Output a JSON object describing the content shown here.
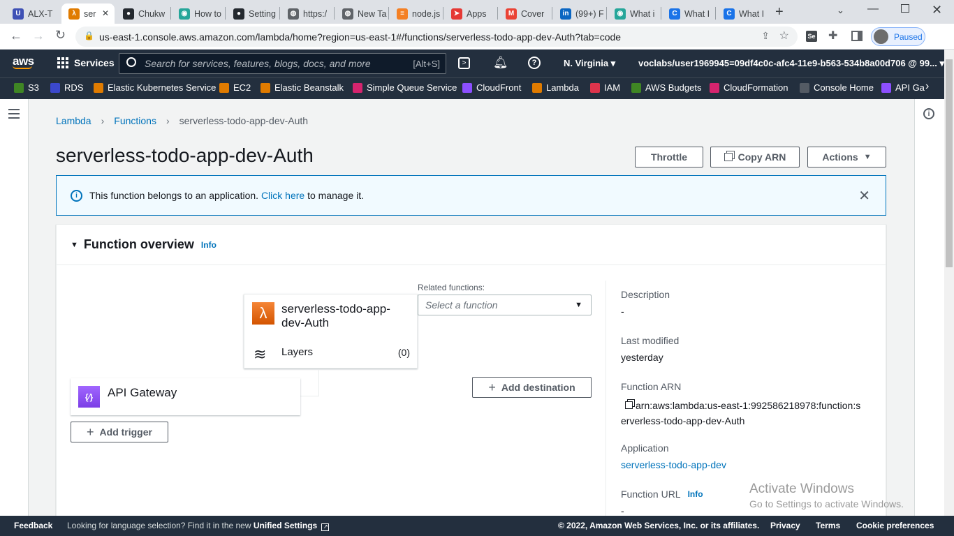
{
  "browser": {
    "tabs": [
      {
        "title": "ALX-T",
        "color": "#3f51b5",
        "glyph": "U"
      },
      {
        "title": "ser",
        "color": "#e07b00",
        "glyph": "λ",
        "active": true
      },
      {
        "title": "Chukw",
        "color": "#24292f",
        "glyph": "●"
      },
      {
        "title": "How to",
        "color": "#26a69a",
        "glyph": "◉"
      },
      {
        "title": "Setting",
        "color": "#24292f",
        "glyph": "●"
      },
      {
        "title": "https:/",
        "color": "#5f6368",
        "glyph": "◍"
      },
      {
        "title": "New Ta",
        "color": "#5f6368",
        "glyph": "◍"
      },
      {
        "title": "node.js",
        "color": "#f48024",
        "glyph": "≡"
      },
      {
        "title": "Apps",
        "color": "#e53935",
        "glyph": "➤"
      },
      {
        "title": "Cover",
        "color": "#ea4335",
        "glyph": "M"
      },
      {
        "title": "(99+) F",
        "color": "#0a66c2",
        "glyph": "in"
      },
      {
        "title": "What i",
        "color": "#26a69a",
        "glyph": "◉"
      },
      {
        "title": "What I",
        "color": "#1a73e8",
        "glyph": "C"
      },
      {
        "title": "What I",
        "color": "#1a73e8",
        "glyph": "C"
      }
    ],
    "url": "us-east-1.console.aws.amazon.com/lambda/home?region=us-east-1#/functions/serverless-todo-app-dev-Auth?tab=code",
    "profile_status": "Paused"
  },
  "awsnav": {
    "logo": "aws",
    "services_label": "Services",
    "search_placeholder": "Search for services, features, blogs, docs, and more",
    "search_shortcut": "[Alt+S]",
    "region": "N. Virginia",
    "account": "voclabs/user1969945=09df4c0c-afc4-11e9-b563-534b8a00d706 @ 99..."
  },
  "favorites": [
    {
      "label": "S3",
      "color": "#3f8624"
    },
    {
      "label": "RDS",
      "color": "#3b48cc"
    },
    {
      "label": "Elastic Kubernetes Service",
      "color": "#e07b00"
    },
    {
      "label": "EC2",
      "color": "#e07b00"
    },
    {
      "label": "Elastic Beanstalk",
      "color": "#e07b00"
    },
    {
      "label": "Simple Queue Service",
      "color": "#d6246e"
    },
    {
      "label": "CloudFront",
      "color": "#8c4fff"
    },
    {
      "label": "Lambda",
      "color": "#e07b00"
    },
    {
      "label": "IAM",
      "color": "#dd344c"
    },
    {
      "label": "AWS Budgets",
      "color": "#3f8624"
    },
    {
      "label": "CloudFormation",
      "color": "#d6246e"
    },
    {
      "label": "Console Home",
      "color": "#545b64"
    },
    {
      "label": "API Ga",
      "color": "#8c4fff"
    }
  ],
  "breadcrumb": {
    "root": "Lambda",
    "functions": "Functions",
    "current": "serverless-todo-app-dev-Auth"
  },
  "page_title": "serverless-todo-app-dev-Auth",
  "actions": {
    "throttle": "Throttle",
    "copy_arn": "Copy ARN",
    "actions": "Actions"
  },
  "alert": {
    "text": "This function belongs to an application.",
    "link": "Click here",
    "suffix": "to manage it."
  },
  "overview": {
    "title": "Function overview",
    "info": "Info",
    "function_name_line1": "serverless-todo-app-",
    "function_name_line2": "dev-Auth",
    "layers_label": "Layers",
    "layers_count": "(0)",
    "related_label": "Related functions:",
    "related_placeholder": "Select a function",
    "trigger_name": "API Gateway",
    "add_trigger": "Add trigger",
    "add_destination": "Add destination"
  },
  "details": {
    "description_label": "Description",
    "description_value": "-",
    "last_modified_label": "Last modified",
    "last_modified_value": "yesterday",
    "arn_label": "Function ARN",
    "arn_line1": "arn:aws:lambda:us-east-1:992586218978:function:s",
    "arn_line2": "erverless-todo-app-dev-Auth",
    "application_label": "Application",
    "application_value": "serverless-todo-app-dev",
    "url_label": "Function URL",
    "url_info": "Info",
    "url_value": "-"
  },
  "watermark": {
    "line1": "Activate Windows",
    "line2": "Go to Settings to activate Windows."
  },
  "footer": {
    "feedback": "Feedback",
    "lang_text": "Looking for language selection? Find it in the new",
    "unified": "Unified Settings",
    "copyright": "© 2022, Amazon Web Services, Inc. or its affiliates.",
    "privacy": "Privacy",
    "terms": "Terms",
    "cookies": "Cookie preferences"
  }
}
